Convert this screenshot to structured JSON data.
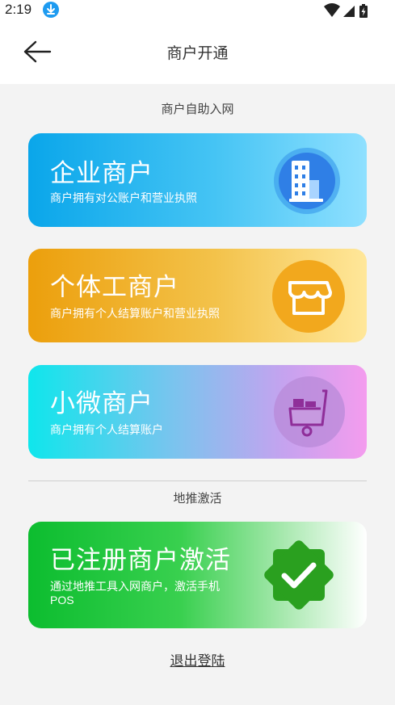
{
  "status_bar": {
    "time": "2:19",
    "icons": [
      "download-icon",
      "wifi-icon",
      "signal-icon",
      "battery-icon"
    ]
  },
  "header": {
    "title": "商户开通",
    "back_icon": "arrow-left-icon"
  },
  "sections": {
    "self_service": "商户自助入网",
    "promotion": "地推激活"
  },
  "cards": {
    "enterprise": {
      "title": "企业商户",
      "description": "商户拥有对公账户和营业执照",
      "icon": "building-icon",
      "colors": [
        "#0aa6ea",
        "#8fe0ff"
      ]
    },
    "individual": {
      "title": "个体工商户",
      "description": "商户拥有个人结算账户和营业执照",
      "icon": "storefront-icon",
      "colors": [
        "#ec9f0c",
        "#ffe79a"
      ]
    },
    "micro": {
      "title": "小微商户",
      "description": "商户拥有个人结算账户",
      "icon": "cart-icon",
      "colors": [
        "#0fe6ec",
        "#f49cee"
      ]
    },
    "activate": {
      "title": "已注册商户激活",
      "description_line1": "通过地推工具入网商户，激活手机",
      "description_line2": "POS",
      "icon": "verified-badge-icon",
      "colors": [
        "#0cbd2f",
        "#ffffff"
      ]
    }
  },
  "footer": {
    "logout": "退出登陆"
  }
}
